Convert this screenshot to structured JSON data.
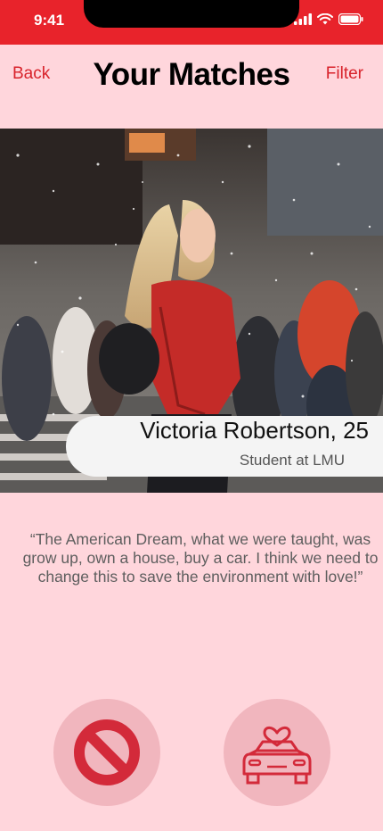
{
  "status_bar": {
    "time": "9:41"
  },
  "header": {
    "back_label": "Back",
    "title": "Your Matches",
    "filter_label": "Filter"
  },
  "profile": {
    "name": "Victoria Robertson, 25",
    "occupation": "Student at LMU",
    "quote": "“The American Dream, what we were taught, was grow up, own a house, buy a car. I think we need to change this to save the environment with love!”"
  },
  "actions": {
    "reject_icon": "block-icon",
    "date_icon": "car-heart-icon"
  },
  "colors": {
    "accent": "#e8232b",
    "background": "#ffd6dc",
    "button_bg": "#f1b6be"
  }
}
